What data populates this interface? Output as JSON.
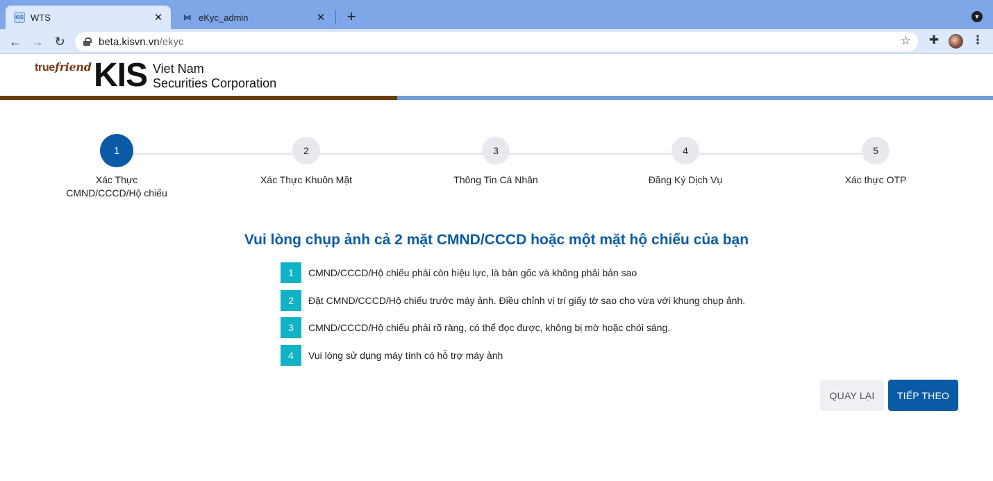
{
  "browser": {
    "tabs": [
      {
        "title": "WTS",
        "active": true,
        "favicon": "KIS"
      },
      {
        "title": "eKyc_admin",
        "active": false,
        "favicon": "⋈"
      }
    ],
    "url_host": "beta.kisvn.vn",
    "url_path": "/ekyc"
  },
  "header": {
    "logo_true": "true",
    "logo_friend": "friend",
    "logo_kis": "KIS",
    "logo_line1": "Viet Nam",
    "logo_line2": "Securities Corporation",
    "colors": {
      "brown_bar": "#6b3d12",
      "blue_bar": "#6f9bd6"
    }
  },
  "stepper": {
    "steps": [
      {
        "number": "1",
        "label": "Xác Thực CMND/CCCD/Hộ chiếu",
        "active": true
      },
      {
        "number": "2",
        "label": "Xác Thực Khuôn Mặt",
        "active": false
      },
      {
        "number": "3",
        "label": "Thông Tin Cá Nhân",
        "active": false
      },
      {
        "number": "4",
        "label": "Đăng Ký Dịch Vụ",
        "active": false
      },
      {
        "number": "5",
        "label": "Xác thực OTP",
        "active": false
      }
    ]
  },
  "main": {
    "title": "Vui lòng chụp ảnh cả 2 mặt CMND/CCCD hoặc một mặt hộ chiếu của bạn",
    "instructions": [
      {
        "number": "1",
        "text": "CMND/CCCD/Hộ chiếu phải còn hiệu lực, là bản gốc và không phải bản sao"
      },
      {
        "number": "2",
        "text": "Đặt CMND/CCCD/Hộ chiếu trước máy ảnh. Điều chỉnh vị trí giấy tờ sao cho vừa với khung chụp ảnh."
      },
      {
        "number": "3",
        "text": "CMND/CCCD/Hộ chiếu phải rõ ràng, có thể đọc được, không bị mờ hoặc chói sáng."
      },
      {
        "number": "4",
        "text": "Vui lòng sử dụng máy tính có hỗ trợ máy ảnh"
      }
    ],
    "back_label": "QUAY LẠI",
    "next_label": "TIẾP THEO",
    "colors": {
      "primary": "#0b5aa6",
      "badge": "#0fb3c4"
    }
  }
}
